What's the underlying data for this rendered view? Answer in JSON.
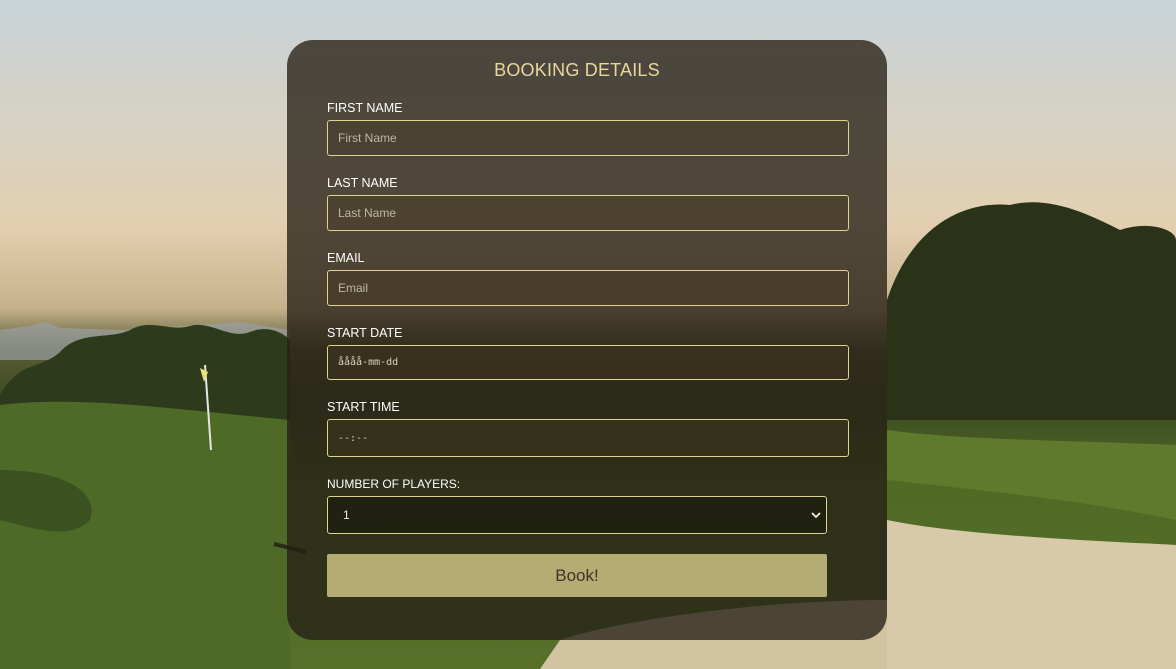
{
  "form": {
    "title": "BOOKING DETAILS",
    "first_name": {
      "label": "FIRST NAME",
      "placeholder": "First Name"
    },
    "last_name": {
      "label": "LAST NAME",
      "placeholder": "Last Name"
    },
    "email": {
      "label": "EMAIL",
      "placeholder": "Email"
    },
    "start_date": {
      "label": "START DATE",
      "placeholder": "åååå-mm-dd"
    },
    "start_time": {
      "label": "START TIME",
      "placeholder": "--:--"
    },
    "players": {
      "label": "NUMBER OF PLAYERS:",
      "value": "1"
    },
    "submit_label": "Book!"
  },
  "colors": {
    "accent": "#e8d79a",
    "border": "#e0d290",
    "button_bg": "#e8dc96"
  },
  "icons": {
    "select_arrow": "chevron-down-icon"
  }
}
